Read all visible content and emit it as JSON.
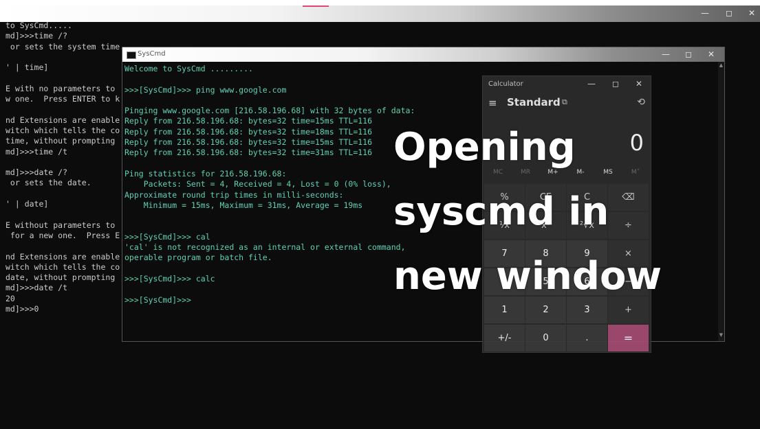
{
  "background_console": {
    "lines": [
      "to SysCmd.....",
      "md]>>>time /?",
      " or sets the system time.",
      "",
      "' | time]",
      "",
      "E with no parameters to",
      "w one.  Press ENTER to k",
      "",
      "nd Extensions are enable",
      "witch which tells the co",
      "time, without prompting",
      "md]>>>time /t",
      "",
      "md]>>>date /?",
      " or sets the date.",
      "",
      "' | date]",
      "",
      "E without parameters to",
      " for a new one.  Press E",
      "",
      "nd Extensions are enable",
      "witch which tells the co",
      "date, without prompting",
      "md]>>>date /t",
      "20",
      "md]>>>0"
    ],
    "controls": {
      "minimize": "—",
      "maximize": "◻",
      "close": "✕"
    }
  },
  "syscmd_window": {
    "title": "SysCmd",
    "controls": {
      "minimize": "—",
      "maximize": "◻",
      "close": "✕"
    },
    "lines": [
      "Welcome to SysCmd .........",
      "",
      ">>>[SysCmd]>>> ping www.google.com",
      "",
      "Pinging www.google.com [216.58.196.68] with 32 bytes of data:",
      "Reply from 216.58.196.68: bytes=32 time=15ms TTL=116",
      "Reply from 216.58.196.68: bytes=32 time=18ms TTL=116",
      "Reply from 216.58.196.68: bytes=32 time=15ms TTL=116",
      "Reply from 216.58.196.68: bytes=32 time=31ms TTL=116",
      "",
      "Ping statistics for 216.58.196.68:",
      "    Packets: Sent = 4, Received = 4, Lost = 0 (0% loss),",
      "Approximate round trip times in milli-seconds:",
      "    Minimum = 15ms, Maximum = 31ms, Average = 19ms",
      "",
      "",
      ">>>[SysCmd]>>> cal",
      "'cal' is not recognized as an internal or external command,",
      "operable program or batch file.",
      "",
      ">>>[SysCmd]>>> calc",
      "",
      ">>>[SysCmd]>>>"
    ]
  },
  "calculator": {
    "title": "Calculator",
    "controls": {
      "minimize": "—",
      "maximize": "◻",
      "close": "✕"
    },
    "mode": "Standard",
    "menu_icon": "hamburger-icon",
    "ontop_icon": "keep-on-top-icon",
    "history_icon": "history-icon",
    "display": "0",
    "memory": [
      "MC",
      "MR",
      "M+",
      "M-",
      "MS",
      "M˅"
    ],
    "keys": [
      [
        "%",
        "CE",
        "C",
        "⌫"
      ],
      [
        "¹⁄x",
        "x²",
        "²√x",
        "÷"
      ],
      [
        "7",
        "8",
        "9",
        "×"
      ],
      [
        "4",
        "5",
        "6",
        "−"
      ],
      [
        "1",
        "2",
        "3",
        "+"
      ],
      [
        "+/-",
        "0",
        ".",
        "="
      ]
    ]
  },
  "overlay": {
    "lines": [
      "Opening",
      "syscmd in",
      "new window"
    ]
  }
}
